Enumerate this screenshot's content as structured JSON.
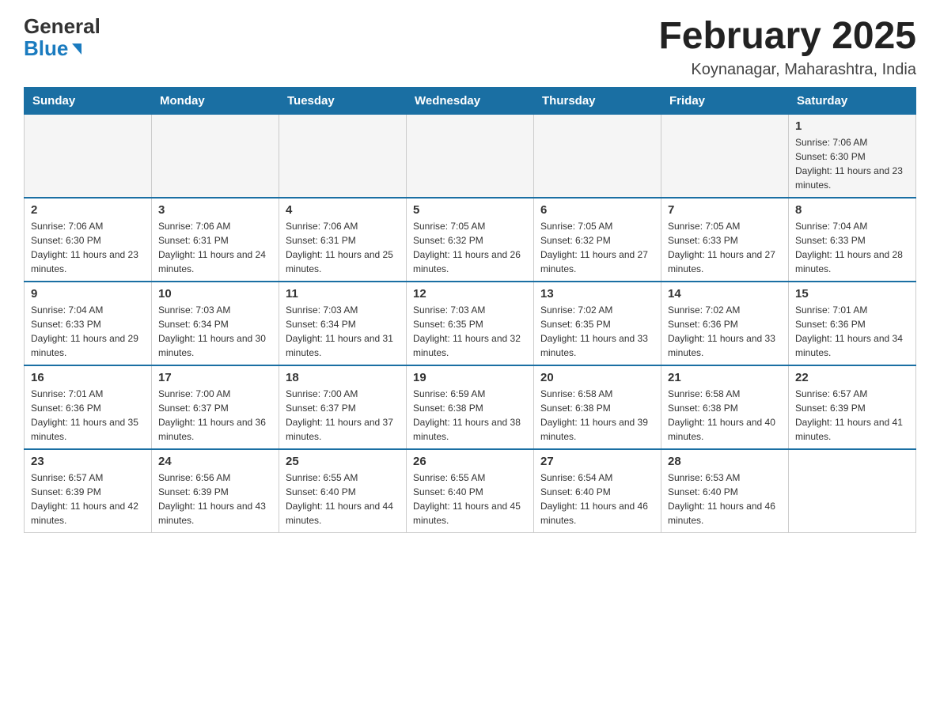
{
  "logo": {
    "general": "General",
    "blue": "Blue"
  },
  "calendar": {
    "title": "February 2025",
    "subtitle": "Koynanagar, Maharashtra, India",
    "headers": [
      "Sunday",
      "Monday",
      "Tuesday",
      "Wednesday",
      "Thursday",
      "Friday",
      "Saturday"
    ]
  },
  "weeks": [
    {
      "days": [
        {
          "number": "",
          "info": ""
        },
        {
          "number": "",
          "info": ""
        },
        {
          "number": "",
          "info": ""
        },
        {
          "number": "",
          "info": ""
        },
        {
          "number": "",
          "info": ""
        },
        {
          "number": "",
          "info": ""
        },
        {
          "number": "1",
          "info": "Sunrise: 7:06 AM\nSunset: 6:30 PM\nDaylight: 11 hours and 23 minutes."
        }
      ]
    },
    {
      "days": [
        {
          "number": "2",
          "info": "Sunrise: 7:06 AM\nSunset: 6:30 PM\nDaylight: 11 hours and 23 minutes."
        },
        {
          "number": "3",
          "info": "Sunrise: 7:06 AM\nSunset: 6:31 PM\nDaylight: 11 hours and 24 minutes."
        },
        {
          "number": "4",
          "info": "Sunrise: 7:06 AM\nSunset: 6:31 PM\nDaylight: 11 hours and 25 minutes."
        },
        {
          "number": "5",
          "info": "Sunrise: 7:05 AM\nSunset: 6:32 PM\nDaylight: 11 hours and 26 minutes."
        },
        {
          "number": "6",
          "info": "Sunrise: 7:05 AM\nSunset: 6:32 PM\nDaylight: 11 hours and 27 minutes."
        },
        {
          "number": "7",
          "info": "Sunrise: 7:05 AM\nSunset: 6:33 PM\nDaylight: 11 hours and 27 minutes."
        },
        {
          "number": "8",
          "info": "Sunrise: 7:04 AM\nSunset: 6:33 PM\nDaylight: 11 hours and 28 minutes."
        }
      ]
    },
    {
      "days": [
        {
          "number": "9",
          "info": "Sunrise: 7:04 AM\nSunset: 6:33 PM\nDaylight: 11 hours and 29 minutes."
        },
        {
          "number": "10",
          "info": "Sunrise: 7:03 AM\nSunset: 6:34 PM\nDaylight: 11 hours and 30 minutes."
        },
        {
          "number": "11",
          "info": "Sunrise: 7:03 AM\nSunset: 6:34 PM\nDaylight: 11 hours and 31 minutes."
        },
        {
          "number": "12",
          "info": "Sunrise: 7:03 AM\nSunset: 6:35 PM\nDaylight: 11 hours and 32 minutes."
        },
        {
          "number": "13",
          "info": "Sunrise: 7:02 AM\nSunset: 6:35 PM\nDaylight: 11 hours and 33 minutes."
        },
        {
          "number": "14",
          "info": "Sunrise: 7:02 AM\nSunset: 6:36 PM\nDaylight: 11 hours and 33 minutes."
        },
        {
          "number": "15",
          "info": "Sunrise: 7:01 AM\nSunset: 6:36 PM\nDaylight: 11 hours and 34 minutes."
        }
      ]
    },
    {
      "days": [
        {
          "number": "16",
          "info": "Sunrise: 7:01 AM\nSunset: 6:36 PM\nDaylight: 11 hours and 35 minutes."
        },
        {
          "number": "17",
          "info": "Sunrise: 7:00 AM\nSunset: 6:37 PM\nDaylight: 11 hours and 36 minutes."
        },
        {
          "number": "18",
          "info": "Sunrise: 7:00 AM\nSunset: 6:37 PM\nDaylight: 11 hours and 37 minutes."
        },
        {
          "number": "19",
          "info": "Sunrise: 6:59 AM\nSunset: 6:38 PM\nDaylight: 11 hours and 38 minutes."
        },
        {
          "number": "20",
          "info": "Sunrise: 6:58 AM\nSunset: 6:38 PM\nDaylight: 11 hours and 39 minutes."
        },
        {
          "number": "21",
          "info": "Sunrise: 6:58 AM\nSunset: 6:38 PM\nDaylight: 11 hours and 40 minutes."
        },
        {
          "number": "22",
          "info": "Sunrise: 6:57 AM\nSunset: 6:39 PM\nDaylight: 11 hours and 41 minutes."
        }
      ]
    },
    {
      "days": [
        {
          "number": "23",
          "info": "Sunrise: 6:57 AM\nSunset: 6:39 PM\nDaylight: 11 hours and 42 minutes."
        },
        {
          "number": "24",
          "info": "Sunrise: 6:56 AM\nSunset: 6:39 PM\nDaylight: 11 hours and 43 minutes."
        },
        {
          "number": "25",
          "info": "Sunrise: 6:55 AM\nSunset: 6:40 PM\nDaylight: 11 hours and 44 minutes."
        },
        {
          "number": "26",
          "info": "Sunrise: 6:55 AM\nSunset: 6:40 PM\nDaylight: 11 hours and 45 minutes."
        },
        {
          "number": "27",
          "info": "Sunrise: 6:54 AM\nSunset: 6:40 PM\nDaylight: 11 hours and 46 minutes."
        },
        {
          "number": "28",
          "info": "Sunrise: 6:53 AM\nSunset: 6:40 PM\nDaylight: 11 hours and 46 minutes."
        },
        {
          "number": "",
          "info": ""
        }
      ]
    }
  ]
}
